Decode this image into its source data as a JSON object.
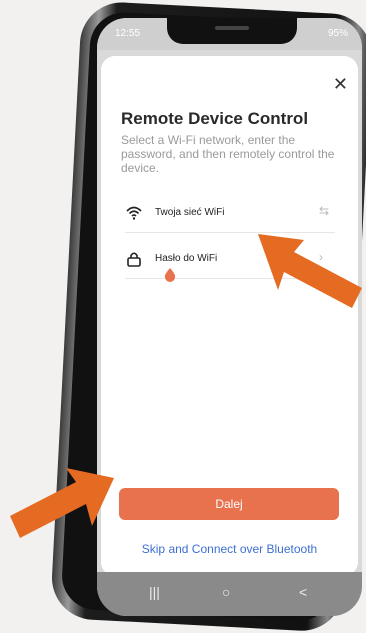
{
  "status_bar": {
    "time": "12:55",
    "battery": "95%"
  },
  "dialog": {
    "title": "Remote Device Control",
    "description": "Select a Wi-Fi network, enter the password, and then remotely control the device.",
    "wifi_label": "Twoja sieć WiFi",
    "password_label": "Hasło do WiFi",
    "next_label": "Dalej",
    "bluetooth_link": "Skip and Connect over Bluetooth"
  },
  "nav": {
    "recents": "|||",
    "home": "○",
    "back": "<"
  },
  "colors": {
    "accent": "#e8724e",
    "link": "#3d6fd0",
    "arrow": "#e56a22"
  },
  "icons": {
    "close": "close-icon",
    "wifi": "wifi-icon",
    "lock": "lock-icon",
    "swap": "swap-icon",
    "water-drop": "water-drop-icon"
  }
}
